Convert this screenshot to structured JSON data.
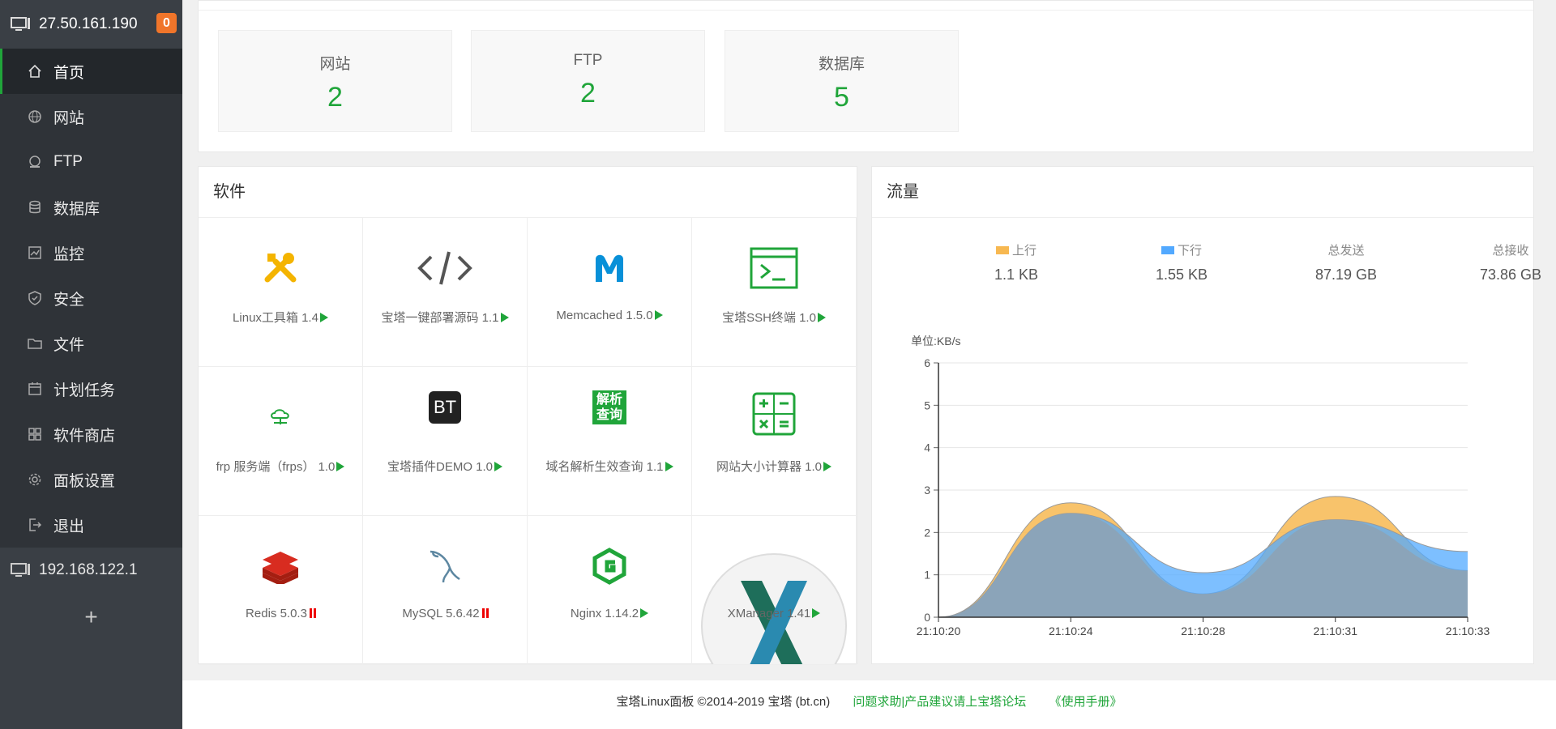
{
  "sidebar": {
    "server_ip": "27.50.161.190",
    "badge": "0",
    "items": [
      {
        "label": "首页",
        "icon": "home-icon"
      },
      {
        "label": "网站",
        "icon": "globe-icon"
      },
      {
        "label": "FTP",
        "icon": "ftp-icon"
      },
      {
        "label": "数据库",
        "icon": "database-icon"
      },
      {
        "label": "监控",
        "icon": "monitor-icon"
      },
      {
        "label": "安全",
        "icon": "shield-icon"
      },
      {
        "label": "文件",
        "icon": "folder-icon"
      },
      {
        "label": "计划任务",
        "icon": "calendar-icon"
      },
      {
        "label": "软件商店",
        "icon": "grid-icon"
      },
      {
        "label": "面板设置",
        "icon": "gear-icon"
      },
      {
        "label": "退出",
        "icon": "logout-icon"
      }
    ],
    "server2_ip": "192.168.122.1",
    "add": "+"
  },
  "stats": [
    {
      "label": "网站",
      "value": "2"
    },
    {
      "label": "FTP",
      "value": "2"
    },
    {
      "label": "数据库",
      "value": "5"
    }
  ],
  "software": {
    "title": "软件",
    "items": [
      {
        "name": "Linux工具箱 1.4",
        "status": "play",
        "icon": "tools-icon"
      },
      {
        "name": "宝塔一键部署源码 1.1",
        "status": "play",
        "icon": "code-icon"
      },
      {
        "name": "Memcached 1.5.0",
        "status": "play",
        "icon": "memcached-icon"
      },
      {
        "name": "宝塔SSH终端 1.0",
        "status": "play",
        "icon": "terminal-icon"
      },
      {
        "name": "frp 服务端（frps） 1.0",
        "status": "play",
        "icon": "frp-icon"
      },
      {
        "name": "宝塔插件DEMO 1.0",
        "status": "play",
        "icon": "bt-icon"
      },
      {
        "name": "域名解析生效查询 1.1",
        "status": "play",
        "icon": "dns-icon"
      },
      {
        "name": "网站大小计算器 1.0",
        "status": "play",
        "icon": "calculator-icon"
      },
      {
        "name": "Redis 5.0.3",
        "status": "pause",
        "icon": "redis-icon"
      },
      {
        "name": "MySQL 5.6.42",
        "status": "pause",
        "icon": "mysql-icon"
      },
      {
        "name": "Nginx 1.14.2",
        "status": "play",
        "icon": "nginx-icon"
      },
      {
        "name": "XManager 1.41",
        "status": "play",
        "icon": "xmanager-icon"
      }
    ],
    "bt_text": "BT",
    "dns_text_1": "解析",
    "dns_text_2": "查询"
  },
  "flow": {
    "title": "流量",
    "up_label": "上行",
    "up_value": "1.1 KB",
    "down_label": "下行",
    "down_value": "1.55 KB",
    "sent_label": "总发送",
    "sent_value": "87.19 GB",
    "recv_label": "总接收",
    "recv_value": "73.86 GB",
    "colors": {
      "up": "#f7b851",
      "down": "#52a9ff"
    }
  },
  "chart_data": {
    "type": "area",
    "ylabel": "单位:KB/s",
    "ylim": [
      0,
      6
    ],
    "yticks": [
      "0",
      "1",
      "2",
      "3",
      "4",
      "5",
      "6"
    ],
    "x": [
      "21:10:20",
      "21:10:24",
      "21:10:28",
      "21:10:31",
      "21:10:33"
    ],
    "series": [
      {
        "name": "上行",
        "values": [
          0,
          2.7,
          0.55,
          2.85,
          1.1
        ]
      },
      {
        "name": "下行",
        "values": [
          0,
          2.45,
          1.05,
          2.3,
          1.55
        ]
      }
    ]
  },
  "footer": {
    "copyright": "宝塔Linux面板 ©2014-2019 宝塔 (bt.cn)",
    "link1": "问题求助|产品建议请上宝塔论坛",
    "link2": "《使用手册》"
  }
}
